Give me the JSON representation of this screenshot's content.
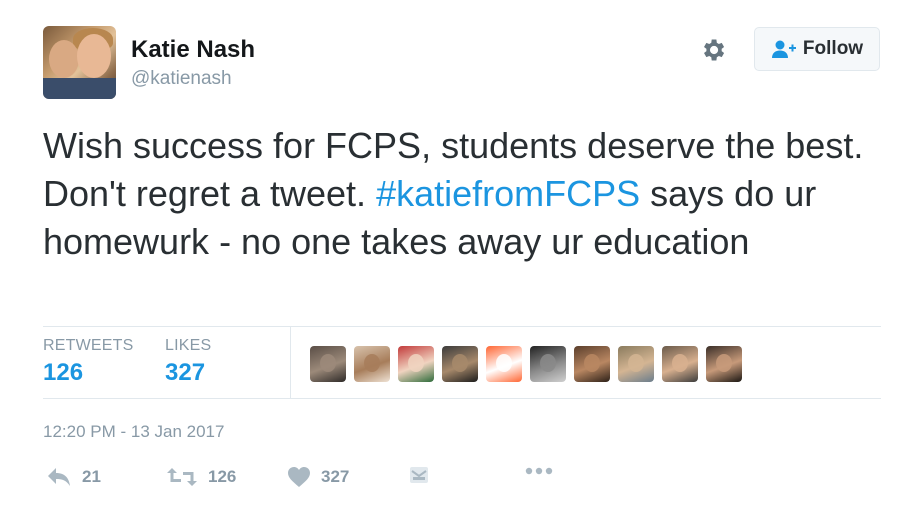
{
  "author": {
    "name": "Katie Nash",
    "handle": "@katienash"
  },
  "follow_button": {
    "label": "Follow"
  },
  "tweet": {
    "text_before": "Wish success for FCPS, students deserve the best. Don't regret a tweet.",
    "hashtag": "#katiefromFCPS",
    "text_after": "says do ur homewurk - no one takes away ur education"
  },
  "stats": {
    "retweets_label": "RETWEETS",
    "retweets_value": "126",
    "likes_label": "LIKES",
    "likes_value": "327"
  },
  "liker_avatars": [
    {
      "colors": [
        "#5a4e46",
        "#9c8a7a",
        "#2e2a28"
      ]
    },
    {
      "colors": [
        "#d8c3ad",
        "#a77d5a",
        "#efe2d4"
      ]
    },
    {
      "colors": [
        "#c23a3a",
        "#f0d3c0",
        "#2e6b3a"
      ]
    },
    {
      "colors": [
        "#3b3b3b",
        "#a7896b",
        "#1c1c1c"
      ]
    },
    {
      "colors": [
        "#ff6633",
        "#ffffff",
        "#ff6633"
      ]
    },
    {
      "colors": [
        "#222222",
        "#8a8a8a",
        "#d0d0d0"
      ]
    },
    {
      "colors": [
        "#5b3f2c",
        "#b98762",
        "#2d2018"
      ]
    },
    {
      "colors": [
        "#8a7b5e",
        "#d4b593",
        "#6a7d8c"
      ]
    },
    {
      "colors": [
        "#6a5a4a",
        "#d8b08f",
        "#3c3c3c"
      ]
    },
    {
      "colors": [
        "#3a2e28",
        "#c79a7a",
        "#1a1612"
      ]
    }
  ],
  "timestamp": "12:20 PM - 13 Jan 2017",
  "actions": {
    "reply_count": "21",
    "retweet_count": "126",
    "like_count": "327"
  },
  "colors": {
    "accent": "#1b95e0",
    "muted": "#8899a6",
    "text": "#292f33"
  }
}
